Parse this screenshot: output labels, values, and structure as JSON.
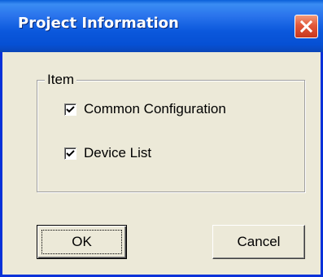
{
  "window": {
    "title": "Project Information",
    "title_color": "#ffffff",
    "titlebar_color": "#0b58dc",
    "close_icon": "close-icon"
  },
  "group": {
    "label": "Item",
    "items": [
      {
        "label": "Common Configuration",
        "checked": true
      },
      {
        "label": "Device List",
        "checked": true
      }
    ]
  },
  "buttons": {
    "ok_label": "OK",
    "cancel_label": "Cancel"
  }
}
